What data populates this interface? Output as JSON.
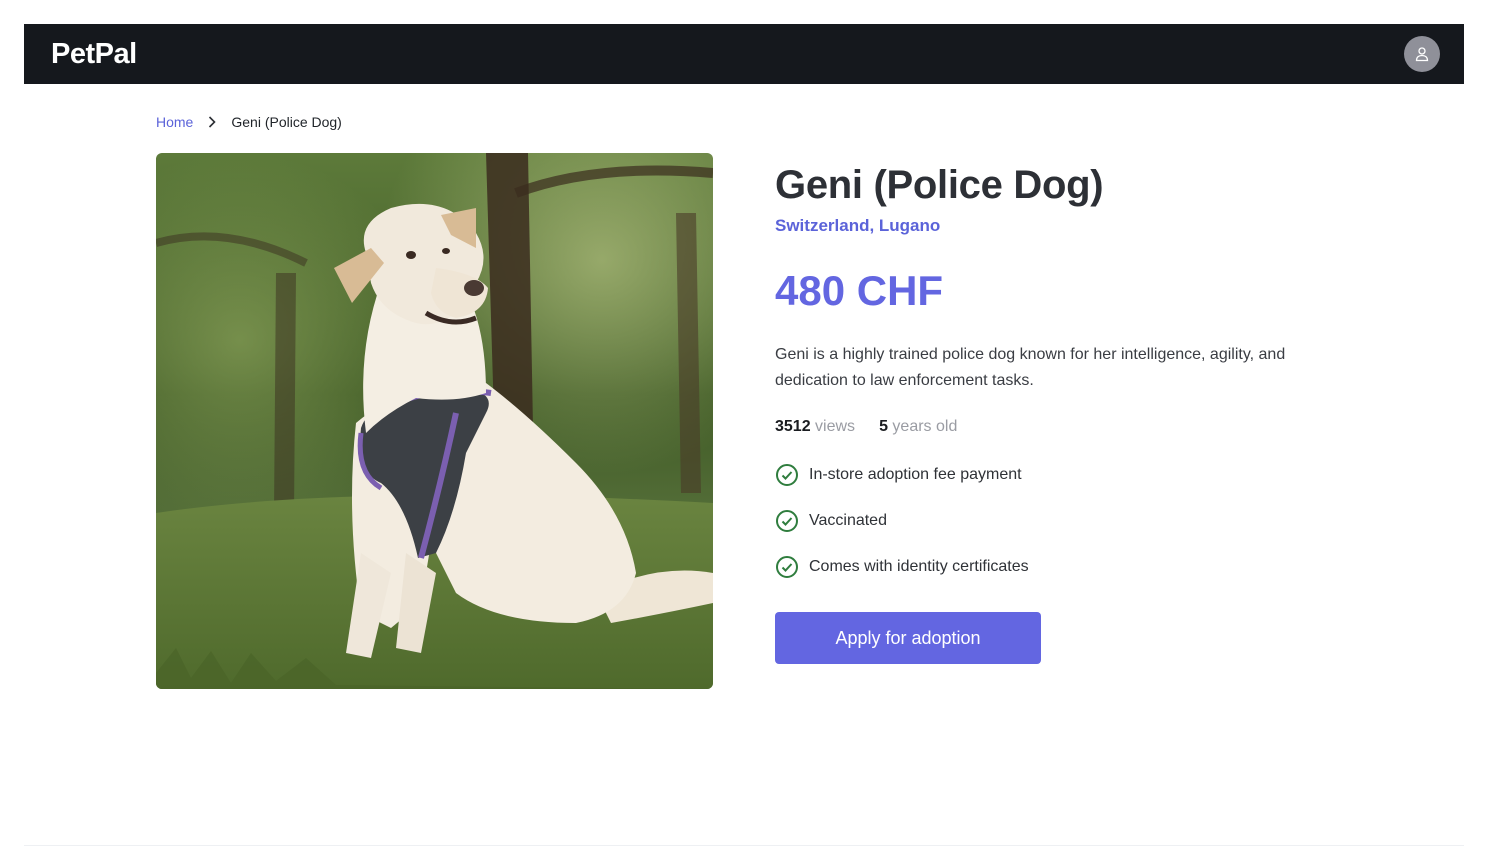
{
  "header": {
    "brand": "PetPal",
    "avatar_icon": "user-icon"
  },
  "breadcrumb": {
    "home": "Home",
    "separator_icon": "chevron-right-icon",
    "current": "Geni (Police Dog)"
  },
  "pet": {
    "name": "Geni (Police Dog)",
    "location": "Switzerland, Lugano",
    "price": "480 CHF",
    "description": "Geni is a highly trained police dog known for her intelligence, agility, and dedication to law enforcement tasks.",
    "views": "3512",
    "views_label": "views",
    "age": "5",
    "age_label": "years old",
    "features": [
      "In-store adoption fee payment",
      "Vaccinated",
      "Comes with identity certificates"
    ],
    "apply_label": "Apply for adoption"
  },
  "colors": {
    "navbar": "#15181d",
    "accent": "#6366e1",
    "check": "#2f7d3e"
  }
}
